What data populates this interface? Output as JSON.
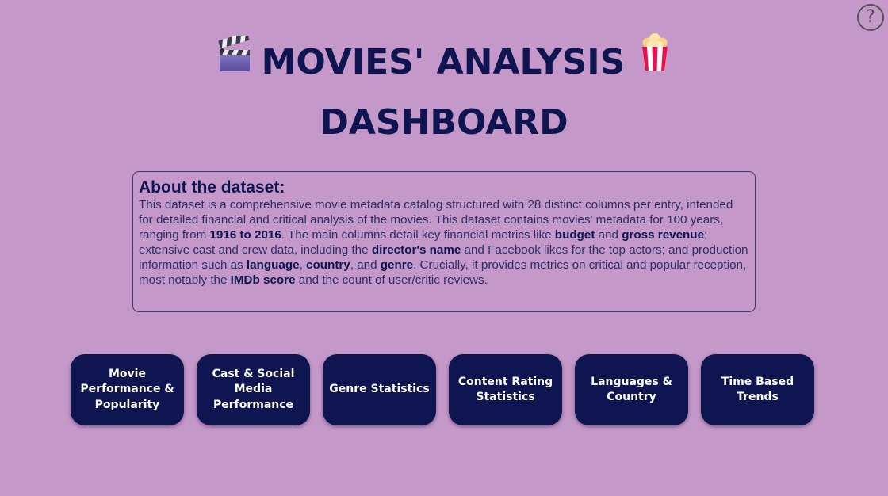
{
  "header": {
    "help_label": "?",
    "title_line1": "MOVIES' ANALYSIS",
    "title_line2": "DASHBOARD",
    "left_icon": "clapperboard-icon",
    "right_icon": "popcorn-icon"
  },
  "about": {
    "heading": "About the dataset:",
    "text_1": "This dataset is a comprehensive movie metadata catalog structured with 28 distinct columns per entry, intended for detailed financial and critical analysis of the movies. This dataset contains movies' metadata for 100 years, ranging from ",
    "bold_years": "1916 to 2016",
    "text_2": ". The main columns detail key financial metrics like ",
    "bold_budget": "budget",
    "text_3": " and ",
    "bold_gross": "gross revenue",
    "text_4": "; extensive cast and crew data, including the ",
    "bold_director": "director's name",
    "text_5": " and Facebook likes for the top actors; and production information such as ",
    "bold_language": "language",
    "text_6": ", ",
    "bold_country": "country",
    "text_7": ", and ",
    "bold_genre": "genre",
    "text_8": ". Crucially, it provides metrics on critical and popular reception, most notably the ",
    "bold_imdb": "IMDb score",
    "text_9": " and the count of user/critic reviews."
  },
  "nav": {
    "buttons": [
      {
        "label": "Movie Performance & Popularity"
      },
      {
        "label": "Cast & Social Media Performance"
      },
      {
        "label": "Genre Statistics"
      },
      {
        "label": "Content Rating Statistics"
      },
      {
        "label": "Languages & Country"
      },
      {
        "label": "Time Based Trends"
      }
    ]
  },
  "colors": {
    "background": "#c498c8",
    "accent": "#0e1550",
    "button_text": "#ffffff"
  }
}
